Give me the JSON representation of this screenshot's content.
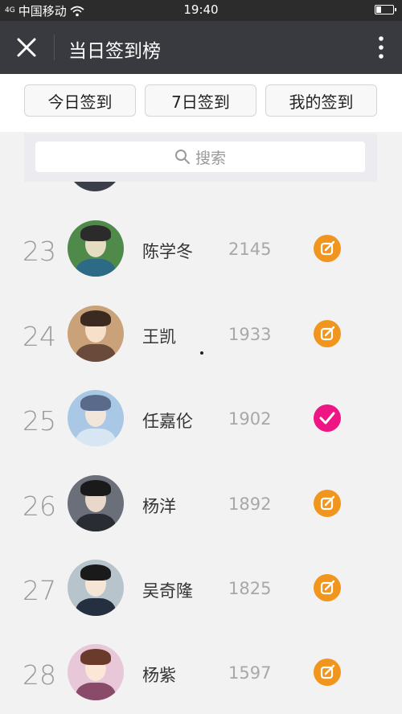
{
  "statusbar": {
    "signal": "4G",
    "carrier": "中国移动",
    "time": "19:40"
  },
  "titlebar": {
    "title": "当日签到榜",
    "close_icon": "close-icon",
    "more_icon": "more-vertical-icon"
  },
  "tabs": [
    {
      "label": "今日签到"
    },
    {
      "label": "7日签到"
    },
    {
      "label": "我的签到"
    }
  ],
  "search": {
    "label": "搜索",
    "icon": "search-icon"
  },
  "colors": {
    "titlebar_bg": "#393a3f",
    "action_orange": "#f0961e",
    "action_pink": "#ee1682"
  },
  "rows": [
    {
      "rank": "23",
      "name": "陈学冬",
      "score": "2145",
      "status": "edit",
      "icon": "edit-icon"
    },
    {
      "rank": "24",
      "name": "王凯",
      "score": "1933",
      "status": "edit",
      "icon": "edit-icon"
    },
    {
      "rank": "25",
      "name": "任嘉伦",
      "score": "1902",
      "status": "checked",
      "icon": "check-icon"
    },
    {
      "rank": "26",
      "name": "杨洋",
      "score": "1892",
      "status": "edit",
      "icon": "edit-icon"
    },
    {
      "rank": "27",
      "name": "吴奇隆",
      "score": "1825",
      "status": "edit",
      "icon": "edit-icon"
    },
    {
      "rank": "28",
      "name": "杨紫",
      "score": "1597",
      "status": "edit",
      "icon": "edit-icon"
    }
  ]
}
